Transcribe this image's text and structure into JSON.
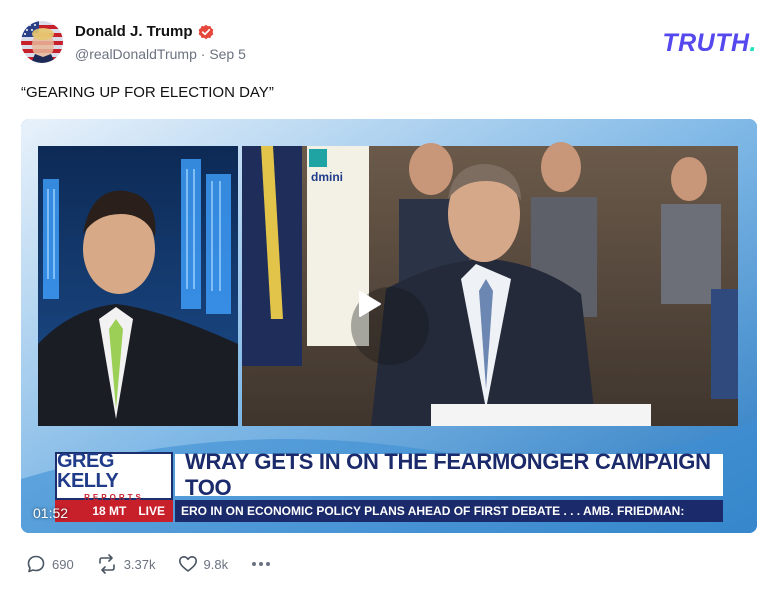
{
  "author": {
    "name": "Donald J. Trump",
    "handle": "@realDonaldTrump",
    "separator": "·",
    "date": "Sep 5",
    "avatar_icon": "avatar-flag-portrait"
  },
  "brand": {
    "logo_text": "TRUTH",
    "logo_dot": ".",
    "color": "#5448ee",
    "dot_color": "#17e3b6"
  },
  "post": {
    "text": "“GEARING UP FOR ELECTION DAY”"
  },
  "video": {
    "duration": "01:52",
    "play_icon": "play-icon",
    "show_logo": {
      "title": "GREG KELLY",
      "subtitle": "REPORTS"
    },
    "headline": "WRAY GETS IN ON THE FEARMONGER CAMPAIGN TOO",
    "time": "18 MT",
    "live_label": "LIVE",
    "ticker": "ERO IN ON ECONOMIC POLICY PLANS AHEAD OF FIRST DEBATE . . .     AMB. FRIEDMAN:"
  },
  "actions": {
    "replies": "690",
    "retruths": "3.37k",
    "likes": "9.8k",
    "reply_icon": "comment-icon",
    "retruth_icon": "repost-icon",
    "like_icon": "heart-icon",
    "more_icon": "more-horizontal-icon"
  }
}
